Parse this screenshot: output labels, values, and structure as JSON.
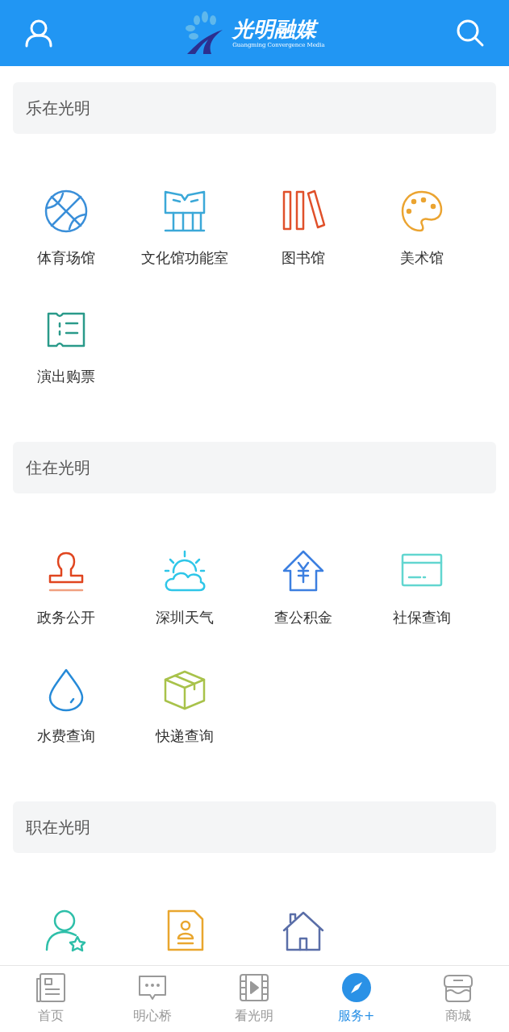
{
  "header": {
    "logo_title": "光明融媒",
    "logo_subtitle": "Guangming Convergence Media"
  },
  "sections": [
    {
      "title": "乐在光明",
      "items": [
        {
          "kind": "basketball",
          "label": "体育场馆"
        },
        {
          "kind": "hall",
          "label": "文化馆功能室"
        },
        {
          "kind": "books",
          "label": "图书馆"
        },
        {
          "kind": "palette",
          "label": "美术馆"
        },
        {
          "kind": "ticket",
          "label": "演出购票"
        }
      ]
    },
    {
      "title": "住在光明",
      "items": [
        {
          "kind": "stamp",
          "label": "政务公开"
        },
        {
          "kind": "weather",
          "label": "深圳天气"
        },
        {
          "kind": "fund",
          "label": "查公积金"
        },
        {
          "kind": "card",
          "label": "社保查询"
        },
        {
          "kind": "drop",
          "label": "水费查询"
        },
        {
          "kind": "box",
          "label": "快递查询"
        }
      ]
    },
    {
      "title": "职在光明",
      "items": [
        {
          "kind": "userstar"
        },
        {
          "kind": "resume"
        },
        {
          "kind": "home"
        }
      ]
    }
  ],
  "tabs": [
    {
      "kind": "news",
      "label": "首页",
      "selected": false
    },
    {
      "kind": "chat",
      "label": "明心桥",
      "selected": false
    },
    {
      "kind": "film",
      "label": "看光明",
      "selected": false
    },
    {
      "kind": "compass",
      "label": "服务+",
      "selected": true
    },
    {
      "kind": "shop",
      "label": "商城",
      "selected": false
    }
  ]
}
